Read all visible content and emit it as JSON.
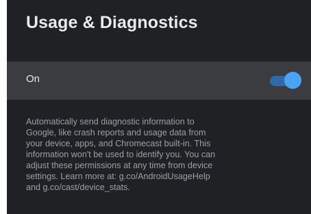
{
  "header": {
    "title": "Usage & Diagnostics"
  },
  "toggle": {
    "label": "On",
    "state": "on",
    "accent_color": "#4aa3f5"
  },
  "description": {
    "lines": [
      "Automatically send diagnostic information to",
      "Google, like crash reports and usage data from",
      "your device, apps, and Chromecast built-in. This",
      "information won't be used to identify you. You can",
      "adjust these permissions at any time from device",
      "settings. Learn more at: g.co/AndroidUsageHelp",
      "and g.co/cast/device_stats."
    ]
  }
}
